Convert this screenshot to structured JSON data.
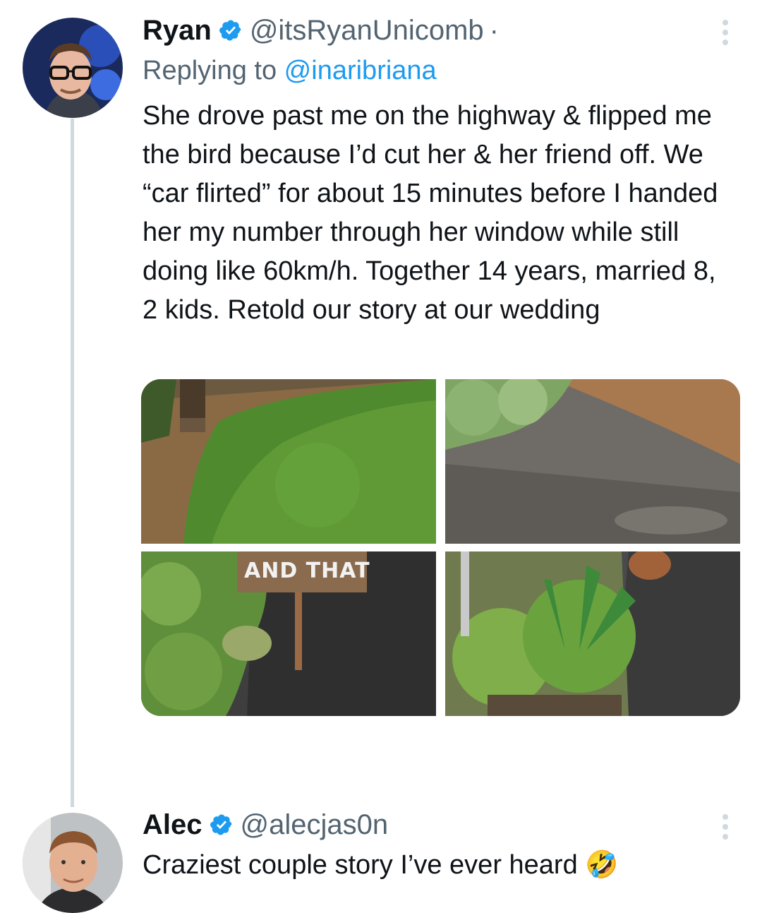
{
  "tweets": [
    {
      "name": "Ryan",
      "handle": "@itsRyanUnicomb",
      "separator": "·",
      "replying_prefix": "Replying to ",
      "replying_to": "@inaribriana",
      "text": "She drove past me on the highway & flipped me the bird because I’d cut her & her friend off. We “car flirted” for about 15 minutes before I handed her my number through her window while still doing like 60km/h. Together 14 years, married 8, 2 kids. Retold our story at our wedding",
      "media": {
        "count": 4,
        "photo3_sign_text": "AND THAT"
      }
    },
    {
      "name": "Alec",
      "handle": "@alecjas0n",
      "text": "Craziest couple story I’ve ever heard 🤣"
    }
  ],
  "icons": {
    "verified": "verified-badge-icon",
    "more": "more-options-icon"
  },
  "colors": {
    "link": "#1d9bf0",
    "secondary_text": "#536471",
    "thread_line": "#cfd9de",
    "verified": "#1d9bf0"
  }
}
